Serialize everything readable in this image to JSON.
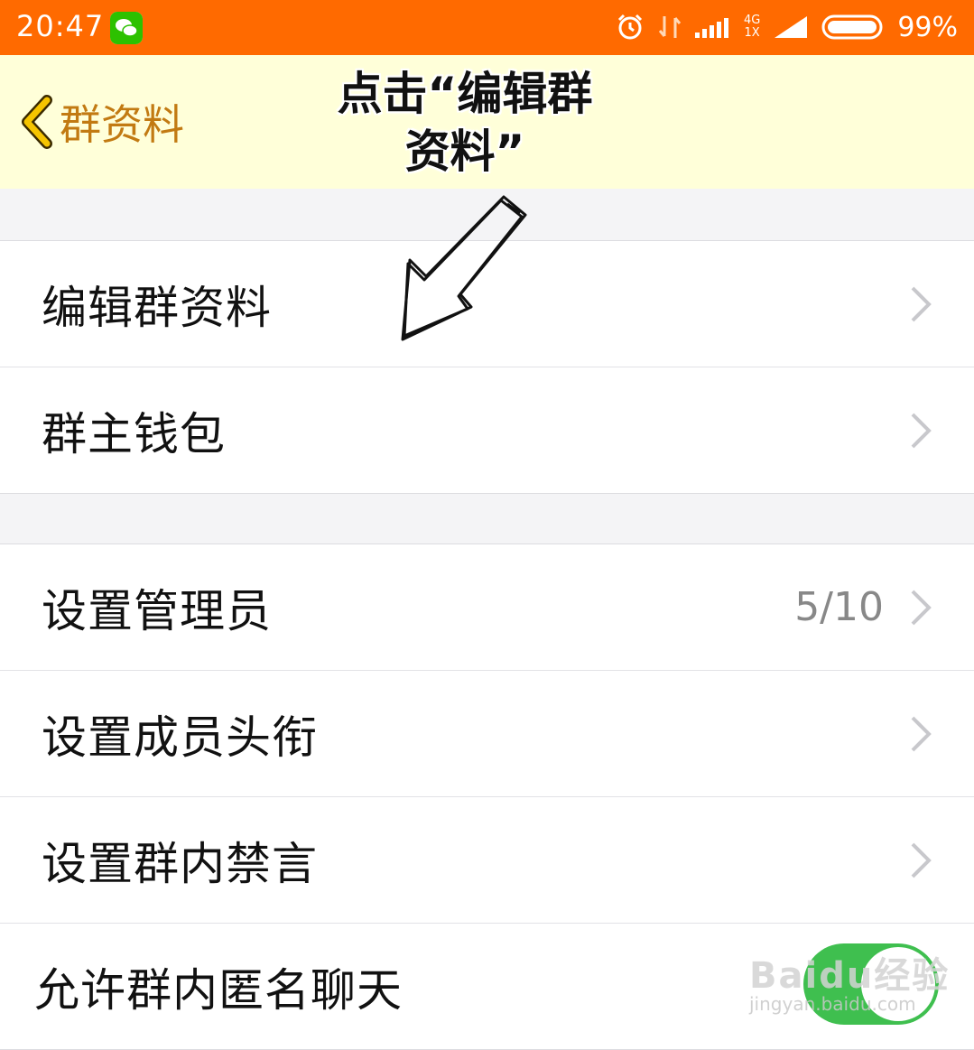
{
  "status_bar": {
    "time": "20:47",
    "network_label": "4G\n1X",
    "battery": "99%"
  },
  "nav": {
    "back_label": "群资料",
    "title_partial": "群资料"
  },
  "annotation": {
    "line1": "点击“编辑群",
    "line2": "资料”"
  },
  "groups": [
    {
      "rows": [
        {
          "label": "编辑群资料"
        },
        {
          "label": "群主钱包"
        }
      ]
    },
    {
      "rows": [
        {
          "label": "设置管理员",
          "value": "5/10"
        },
        {
          "label": "设置成员头衔"
        },
        {
          "label": "设置群内禁言"
        }
      ]
    }
  ],
  "anonymous_chat": {
    "label": "允许群内匿名聊天",
    "enabled": true
  },
  "watermark": {
    "text": "Baidu经验",
    "url": "jingyan.baidu.com"
  },
  "colors": {
    "status_bar": "#ff6a00",
    "nav_bar": "#ffffd9",
    "back_accent": "#c27a12",
    "toggle_on": "#3fbf4f"
  }
}
